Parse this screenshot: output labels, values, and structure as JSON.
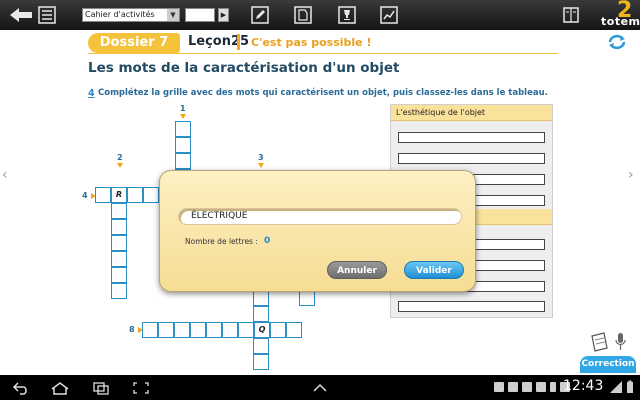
{
  "toolbar": {
    "chapter_select": "Cahier d'activités",
    "page_value": "",
    "go_label": "▶"
  },
  "logo": {
    "number": "2",
    "text": "totem"
  },
  "header": {
    "dossier": "Dossier 7",
    "lecon": "Leçon25",
    "lecon_title": "C'est pas possible !"
  },
  "page_title": "Les mots de la caractérisation d'un objet",
  "instruction": {
    "number": "4",
    "text": "Complétez la grille avec des mots qui caractérisent un objet, puis classez-les dans le tableau."
  },
  "crossword": {
    "clues": [
      "1",
      "2",
      "3",
      "4",
      "8"
    ],
    "letters": {
      "r": "R",
      "q": "Q"
    }
  },
  "table": {
    "header_1": "L'esthétique de l'objet"
  },
  "dialog": {
    "answer": "ÉLECTRIQUE",
    "letters_label": "Nombre de lettres :",
    "letters_count": "0",
    "cancel": "Annuler",
    "validate": "Valider"
  },
  "correction_label": "Correction",
  "status": {
    "time": "12:43"
  },
  "colors": {
    "accent": "#f5c33b",
    "blue": "#2a87c4",
    "title": "#234a63"
  }
}
